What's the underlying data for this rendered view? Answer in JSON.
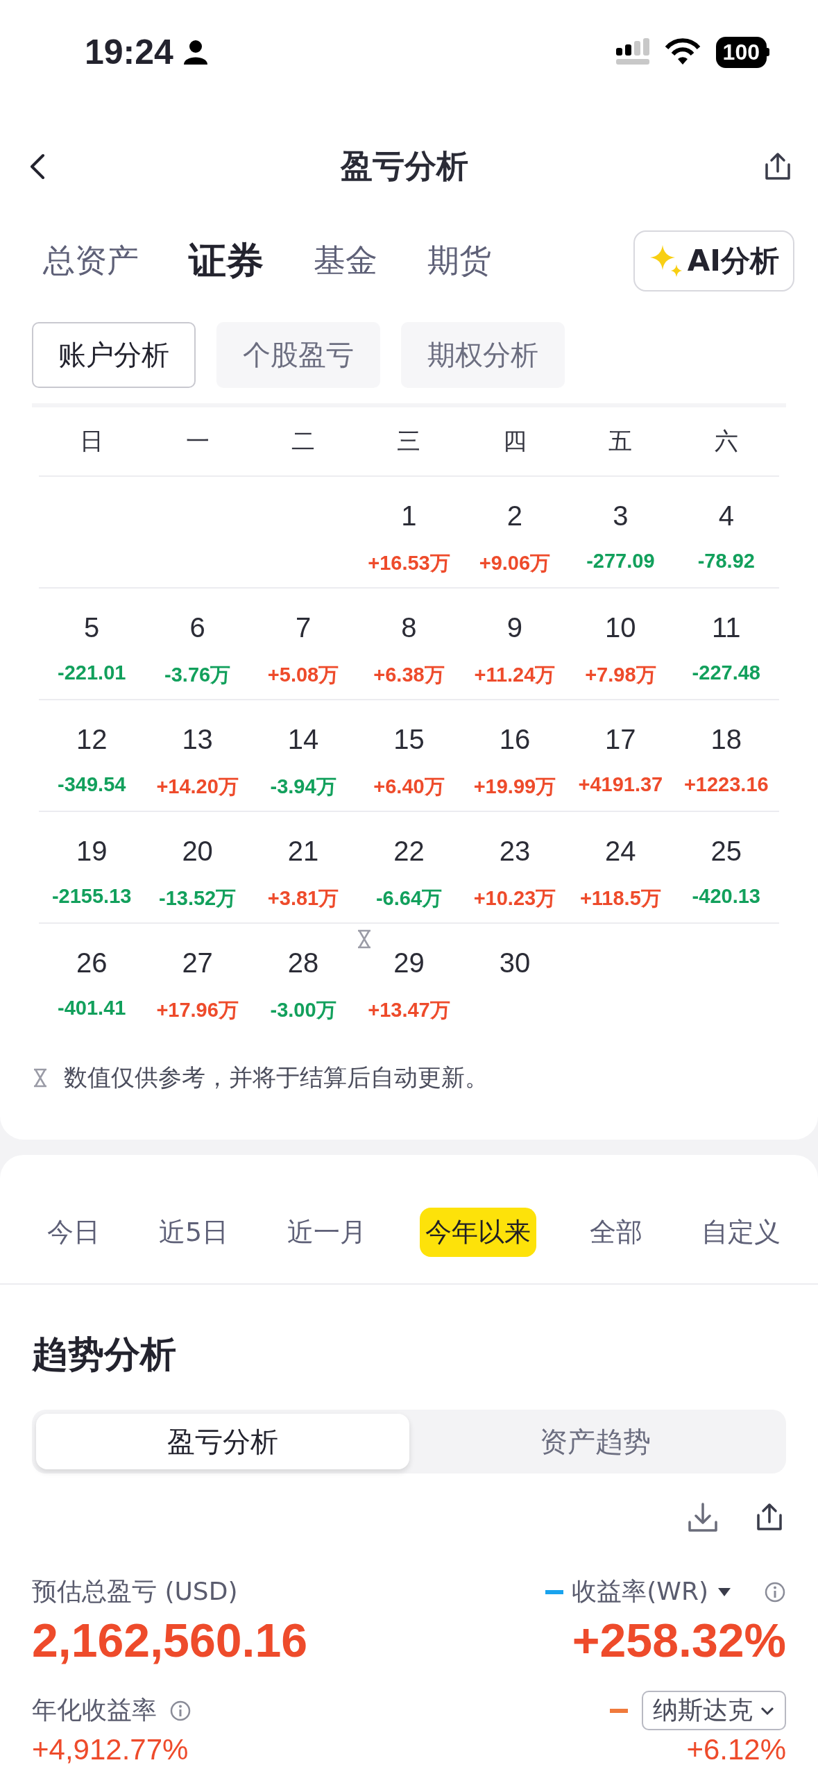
{
  "status_bar": {
    "time": "19:24",
    "battery": "100"
  },
  "nav": {
    "title": "盈亏分析"
  },
  "asset_tabs": [
    {
      "label": "总资产",
      "selected": false
    },
    {
      "label": "证券",
      "selected": true
    },
    {
      "label": "基金",
      "selected": false
    },
    {
      "label": "期货",
      "selected": false
    }
  ],
  "ai_button": {
    "label": "AI分析"
  },
  "analysis_tabs": [
    {
      "label": "账户分析",
      "selected": true
    },
    {
      "label": "个股盈亏",
      "selected": false
    },
    {
      "label": "期权分析",
      "selected": false
    }
  ],
  "calendar": {
    "weekdays": [
      "日",
      "一",
      "二",
      "三",
      "四",
      "五",
      "六"
    ],
    "weeks": [
      [
        {
          "kind": "empty"
        },
        {
          "kind": "empty"
        },
        {
          "kind": "empty"
        },
        {
          "kind": "day",
          "day": "1",
          "pnl": "+16.53万",
          "color": "#ee4b2b",
          "pending": false
        },
        {
          "kind": "day",
          "day": "2",
          "pnl": "+9.06万",
          "color": "#ee4b2b",
          "pending": false
        },
        {
          "kind": "day",
          "day": "3",
          "pnl": "-277.09",
          "color": "#12a05c",
          "pending": false
        },
        {
          "kind": "day",
          "day": "4",
          "pnl": "-78.92",
          "color": "#12a05c",
          "pending": false
        }
      ],
      [
        {
          "kind": "day",
          "day": "5",
          "pnl": "-221.01",
          "color": "#12a05c",
          "pending": false
        },
        {
          "kind": "day",
          "day": "6",
          "pnl": "-3.76万",
          "color": "#12a05c",
          "pending": false
        },
        {
          "kind": "day",
          "day": "7",
          "pnl": "+5.08万",
          "color": "#ee4b2b",
          "pending": false
        },
        {
          "kind": "day",
          "day": "8",
          "pnl": "+6.38万",
          "color": "#ee4b2b",
          "pending": false
        },
        {
          "kind": "day",
          "day": "9",
          "pnl": "+11.24万",
          "color": "#ee4b2b",
          "pending": false
        },
        {
          "kind": "day",
          "day": "10",
          "pnl": "+7.98万",
          "color": "#ee4b2b",
          "pending": false
        },
        {
          "kind": "day",
          "day": "11",
          "pnl": "-227.48",
          "color": "#12a05c",
          "pending": false
        }
      ],
      [
        {
          "kind": "day",
          "day": "12",
          "pnl": "-349.54",
          "color": "#12a05c",
          "pending": false
        },
        {
          "kind": "day",
          "day": "13",
          "pnl": "+14.20万",
          "color": "#ee4b2b",
          "pending": false
        },
        {
          "kind": "day",
          "day": "14",
          "pnl": "-3.94万",
          "color": "#12a05c",
          "pending": false
        },
        {
          "kind": "day",
          "day": "15",
          "pnl": "+6.40万",
          "color": "#ee4b2b",
          "pending": false
        },
        {
          "kind": "day",
          "day": "16",
          "pnl": "+19.99万",
          "color": "#ee4b2b",
          "pending": false
        },
        {
          "kind": "day",
          "day": "17",
          "pnl": "+4191.37",
          "color": "#ee4b2b",
          "pending": false
        },
        {
          "kind": "day",
          "day": "18",
          "pnl": "+1223.16",
          "color": "#ee4b2b",
          "pending": false
        }
      ],
      [
        {
          "kind": "day",
          "day": "19",
          "pnl": "-2155.13",
          "color": "#12a05c",
          "pending": false
        },
        {
          "kind": "day",
          "day": "20",
          "pnl": "-13.52万",
          "color": "#12a05c",
          "pending": false
        },
        {
          "kind": "day",
          "day": "21",
          "pnl": "+3.81万",
          "color": "#ee4b2b",
          "pending": false
        },
        {
          "kind": "day",
          "day": "22",
          "pnl": "-6.64万",
          "color": "#12a05c",
          "pending": false
        },
        {
          "kind": "day",
          "day": "23",
          "pnl": "+10.23万",
          "color": "#ee4b2b",
          "pending": false
        },
        {
          "kind": "day",
          "day": "24",
          "pnl": "+118.5万",
          "color": "#ee4b2b",
          "pending": false
        },
        {
          "kind": "day",
          "day": "25",
          "pnl": "-420.13",
          "color": "#12a05c",
          "pending": false
        }
      ],
      [
        {
          "kind": "day",
          "day": "26",
          "pnl": "-401.41",
          "color": "#12a05c",
          "pending": false
        },
        {
          "kind": "day",
          "day": "27",
          "pnl": "+17.96万",
          "color": "#ee4b2b",
          "pending": false
        },
        {
          "kind": "day",
          "day": "28",
          "pnl": "-3.00万",
          "color": "#12a05c",
          "pending": false
        },
        {
          "kind": "day",
          "day": "29",
          "pnl": "+13.47万",
          "color": "#ee4b2b",
          "pending": true
        },
        {
          "kind": "day",
          "day": "30",
          "pending": false
        },
        {
          "kind": "empty"
        },
        {
          "kind": "empty"
        }
      ]
    ],
    "note": "数值仅供参考，并将于结算后自动更新。"
  },
  "range_tabs": [
    {
      "label": "今日",
      "selected": false
    },
    {
      "label": "近5日",
      "selected": false
    },
    {
      "label": "近一月",
      "selected": false
    },
    {
      "label": "今年以来",
      "selected": true
    },
    {
      "label": "全部",
      "selected": false
    },
    {
      "label": "自定义",
      "selected": false
    }
  ],
  "trend": {
    "title": "趋势分析",
    "segments": [
      {
        "label": "盈亏分析",
        "selected": true
      },
      {
        "label": "资产趋势",
        "selected": false
      }
    ],
    "total": {
      "label": "预估总盈亏 (USD)",
      "value": "2,162,560.16"
    },
    "return_rate": {
      "label": "收益率(WR)",
      "color": "#19a3ee",
      "value": "+258.32%"
    },
    "annualized": {
      "label": "年化收益率",
      "value": "+4,912.77%"
    },
    "benchmark": {
      "label": "纳斯达克",
      "color": "#f07a3c",
      "value": "+6.12%"
    }
  }
}
